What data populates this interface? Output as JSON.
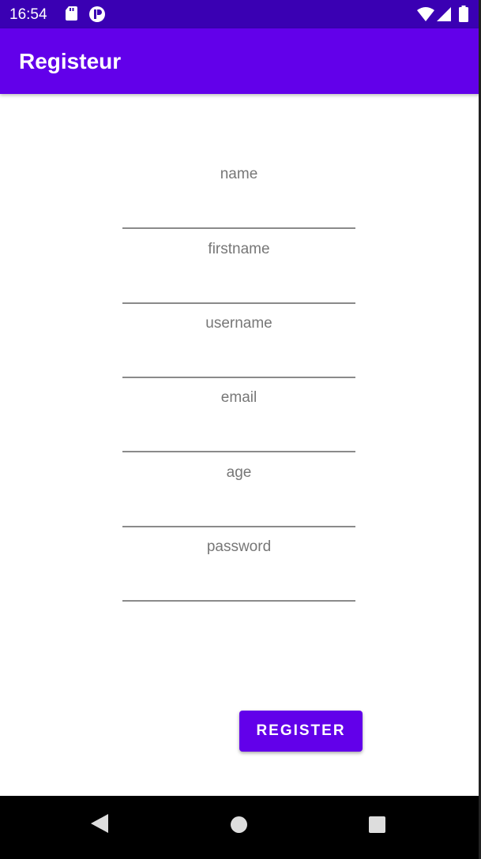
{
  "status_bar": {
    "time": "16:54",
    "icons": [
      "sd-card-icon",
      "app-notification-icon",
      "wifi-icon",
      "signal-icon",
      "battery-icon"
    ]
  },
  "app_bar": {
    "title": "Registeur"
  },
  "form": {
    "fields": [
      {
        "hint": "name"
      },
      {
        "hint": "firstname"
      },
      {
        "hint": "username"
      },
      {
        "hint": "email"
      },
      {
        "hint": "age"
      },
      {
        "hint": "password"
      }
    ]
  },
  "register_button": {
    "label": "REGISTER"
  },
  "colors": {
    "primary": "#6200ea",
    "status_bar": "#3a00b3",
    "hint": "#777777"
  }
}
